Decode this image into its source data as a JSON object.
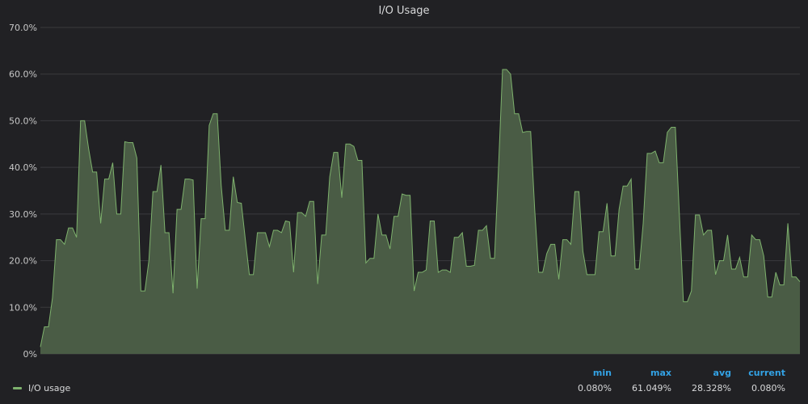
{
  "panel": {
    "title": "I/O Usage"
  },
  "legend": {
    "series_label": "I/O usage",
    "headers": {
      "min": "min",
      "max": "max",
      "avg": "avg",
      "current": "current"
    },
    "values": {
      "min": "0.080%",
      "max": "61.049%",
      "avg": "28.328%",
      "current": "0.080%"
    }
  },
  "colors": {
    "line": "#7eb26d",
    "fill": "#4a5c45",
    "grid": "#3a3a3d",
    "legend_header": "#33a2e5"
  },
  "chart_data": {
    "type": "area",
    "title": "I/O Usage",
    "xlabel": "",
    "ylabel": "",
    "ylim": [
      0,
      70
    ],
    "yticks": [
      0,
      10,
      20,
      30,
      40,
      50,
      60,
      70
    ],
    "ytick_labels": [
      "0%",
      "10.0%",
      "20.0%",
      "30.0%",
      "40.0%",
      "50.0%",
      "60.0%",
      "70.0%"
    ],
    "grid": true,
    "legend_position": "bottom-left",
    "series": [
      {
        "name": "I/O usage",
        "values": [
          1.5,
          5.8,
          5.8,
          12,
          24.5,
          24.5,
          23.5,
          27,
          27,
          25,
          50,
          50,
          44,
          39,
          39,
          28,
          37.5,
          37.5,
          41,
          30,
          30,
          45.5,
          45.3,
          45.3,
          42,
          13.5,
          13.5,
          20,
          34.8,
          34.8,
          40.5,
          26,
          26,
          13,
          31,
          31,
          37.5,
          37.5,
          37.3,
          14,
          29,
          29,
          49,
          51.5,
          51.5,
          36,
          26.5,
          26.5,
          38,
          32.5,
          32.3,
          24.5,
          17,
          17,
          26,
          26,
          26,
          23,
          26.5,
          26.5,
          26,
          28.5,
          28.3,
          17.5,
          30.3,
          30.3,
          29.5,
          32.7,
          32.7,
          15,
          25.5,
          25.5,
          38,
          43.2,
          43.2,
          33.5,
          45,
          45,
          44.5,
          41.5,
          41.5,
          19.5,
          20.5,
          20.5,
          30,
          25.5,
          25.5,
          22.5,
          29.5,
          29.5,
          34.3,
          34,
          34,
          13.5,
          17.5,
          17.5,
          18,
          28.5,
          28.5,
          17.5,
          18,
          18,
          17.5,
          25,
          25,
          26,
          18.8,
          18.8,
          19,
          26.5,
          26.5,
          27.5,
          20.5,
          20.5,
          40,
          61,
          61,
          60,
          51.5,
          51.5,
          47.5,
          47.7,
          47.7,
          31,
          17.5,
          17.5,
          21.5,
          23.5,
          23.5,
          16,
          24.5,
          24.5,
          23.5,
          34.8,
          34.8,
          22,
          17,
          17,
          17,
          26.2,
          26.2,
          32.3,
          21,
          21,
          31,
          36,
          36,
          37.5,
          18.2,
          18.2,
          28,
          43,
          43,
          43.5,
          41,
          41,
          47.5,
          48.6,
          48.6,
          30,
          11.2,
          11.2,
          13.5,
          29.8,
          29.8,
          25.5,
          26.5,
          26.5,
          17,
          20,
          20,
          25.5,
          18.2,
          18.2,
          20.7,
          16.5,
          16.5,
          25.5,
          24.5,
          24.5,
          21,
          12.2,
          12.2,
          17.5,
          14.8,
          14.8,
          28,
          16.5,
          16.5,
          15.5
        ]
      }
    ]
  }
}
